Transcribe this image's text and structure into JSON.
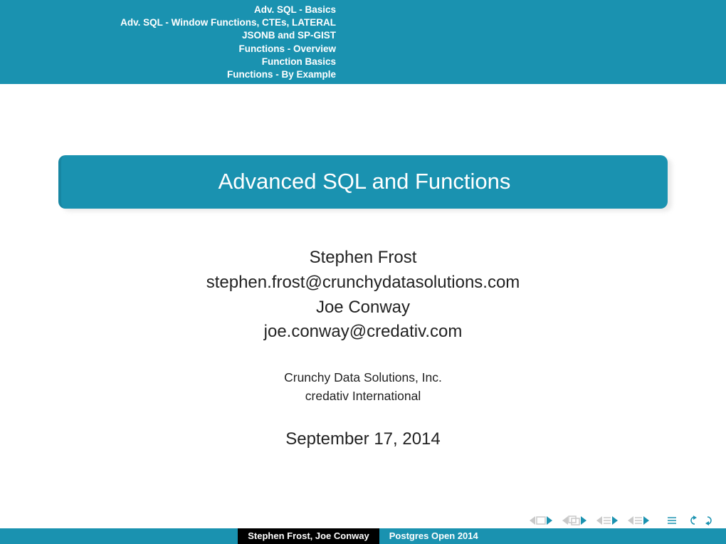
{
  "nav": {
    "items": [
      "Adv. SQL - Basics",
      "Adv. SQL - Window Functions, CTEs, LATERAL",
      "JSONB and SP-GIST",
      "Functions - Overview",
      "Function Basics",
      "Functions - By Example"
    ]
  },
  "title": "Advanced SQL and Functions",
  "authors": {
    "name1": "Stephen Frost",
    "email1": "stephen.frost@crunchydatasolutions.com",
    "name2": "Joe Conway",
    "email2": "joe.conway@credativ.com"
  },
  "affiliations": {
    "line1": "Crunchy Data Solutions, Inc.",
    "line2": "credativ International"
  },
  "date": "September 17, 2014",
  "footer": {
    "authors": "Stephen Frost, Joe Conway",
    "event": "Postgres Open 2014"
  }
}
